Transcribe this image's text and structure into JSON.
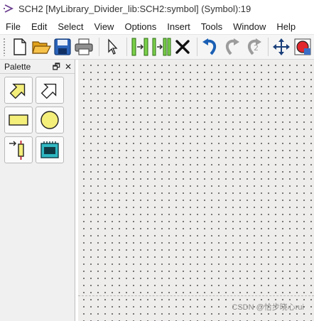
{
  "window": {
    "title": "SCH2 [MyLibrary_Divider_lib:SCH2:symbol] (Symbol):19"
  },
  "menu": [
    {
      "label": "File",
      "key": "file"
    },
    {
      "label": "Edit",
      "key": "edit"
    },
    {
      "label": "Select",
      "key": "select"
    },
    {
      "label": "View",
      "key": "view"
    },
    {
      "label": "Options",
      "key": "options"
    },
    {
      "label": "Insert",
      "key": "insert"
    },
    {
      "label": "Tools",
      "key": "tools"
    },
    {
      "label": "Window",
      "key": "window"
    },
    {
      "label": "Help",
      "key": "help"
    }
  ],
  "toolbar": {
    "buttons": [
      "new-file-icon",
      "open-folder-icon",
      "save-icon",
      "print-icon",
      "select-arrow-icon",
      "add-pin-icon",
      "add-pins-icon",
      "delete-icon",
      "undo-icon",
      "redo-icon",
      "reset-icon",
      "move-icon",
      "zoom-icon"
    ]
  },
  "palette": {
    "title": "Palette",
    "restore_glyph": "🗗",
    "close_glyph": "✕",
    "tools": [
      "input-pin-shape-icon",
      "output-pin-shape-icon",
      "rectangle-shape-icon",
      "circle-shape-icon",
      "pin-tool-icon",
      "symbol-tool-icon"
    ]
  },
  "watermark": "CSDN @恰步晓心rui",
  "colors": {
    "canvas": "#efedeb",
    "shape_fill": "#f4ee7a",
    "accent_blue": "#1a5fb4",
    "accent_green": "#3a9d23"
  }
}
